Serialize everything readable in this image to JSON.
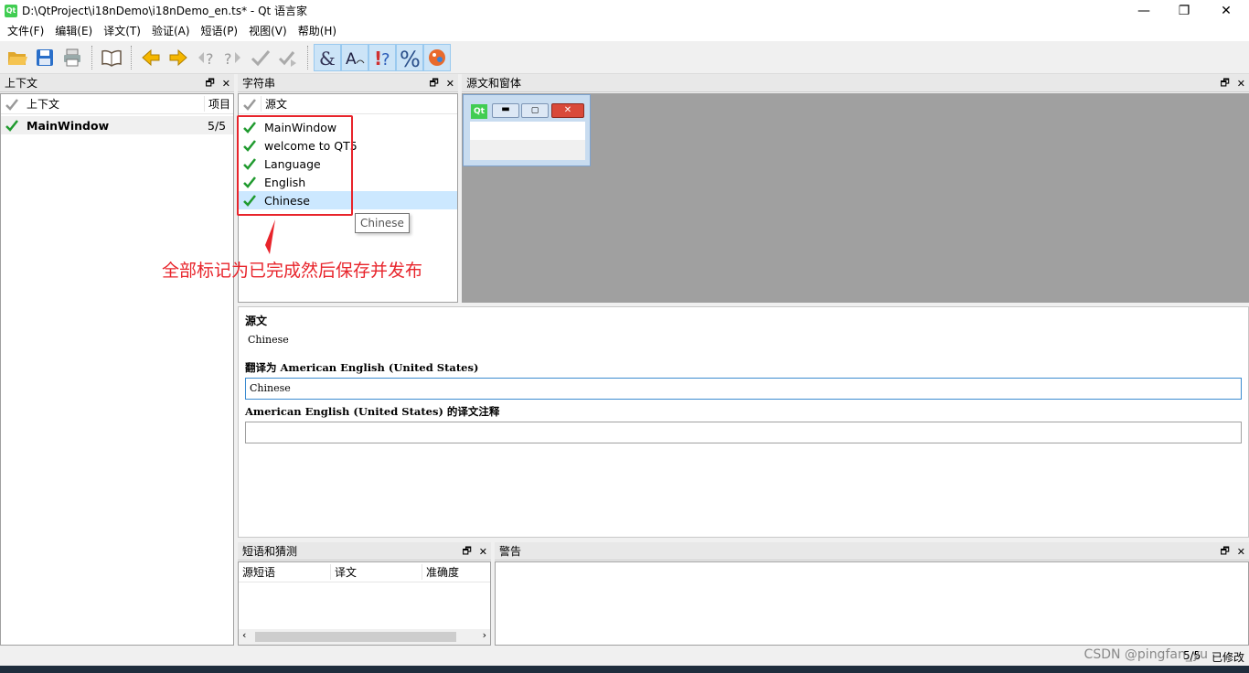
{
  "window": {
    "title": "D:\\QtProject\\i18nDemo\\i18nDemo_en.ts* - Qt 语言家",
    "icon": "Qt",
    "minimize": "—",
    "maximize": "❐",
    "close": "✕"
  },
  "menu": [
    "文件(F)",
    "编辑(E)",
    "译文(T)",
    "验证(A)",
    "短语(P)",
    "视图(V)",
    "帮助(H)"
  ],
  "context_dock": {
    "title": "上下文",
    "col_context": "上下文",
    "col_items": "项目",
    "rows": [
      {
        "name": "MainWindow",
        "count": "5/5"
      }
    ]
  },
  "strings_dock": {
    "title": "字符串",
    "col_source": "源文",
    "rows": [
      "MainWindow",
      "welcome to QT5",
      "Language",
      "English",
      "Chinese"
    ]
  },
  "preview_dock": {
    "title": "源文和窗体",
    "mini_icon": "Qt"
  },
  "tooltip": "Chinese",
  "annotation": "全部标记为已完成然后保存并发布",
  "editor": {
    "source_label": "源文",
    "source_text": "Chinese",
    "translate_label": "翻译为 American English (United States)",
    "translation_value": "Chinese",
    "comment_label": "American English (United States) 的译文注释",
    "comment_value": ""
  },
  "phrases_dock": {
    "title": "短语和猜测",
    "col_source": "源短语",
    "col_translation": "译文",
    "col_accuracy": "准确度"
  },
  "warnings_dock": {
    "title": "警告"
  },
  "status": {
    "progress": "5/5",
    "modified": "已修改"
  },
  "watermark": "CSDN @pingfan_yu",
  "colors": {
    "annotation": "#e8242b",
    "check_green": "#1f9a2e",
    "selection": "#cce8ff",
    "preview_bg": "#a0a0a0"
  }
}
